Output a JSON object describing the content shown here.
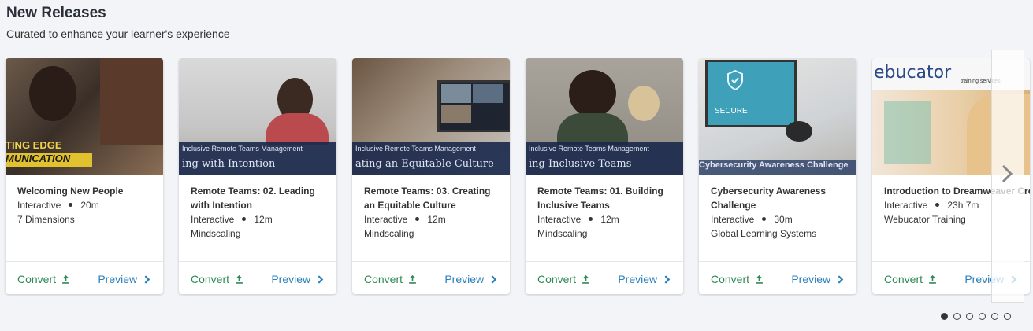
{
  "section": {
    "title": "New Releases",
    "subtitle": "Curated to enhance your learner's experience"
  },
  "colors": {
    "convert": "#2e8b57",
    "preview": "#2a7fba",
    "background": "#f3f4f7"
  },
  "cards": [
    {
      "title": "Welcoming New People",
      "type": "Interactive",
      "duration": "20m",
      "provider": "7 Dimensions",
      "thumb_text_1": "TING EDGE",
      "thumb_text_2": "MUNICATION",
      "convert": "Convert",
      "preview": "Preview"
    },
    {
      "title": "Remote Teams: 02. Leading with Intention",
      "type": "Interactive",
      "duration": "12m",
      "provider": "Mindscaling",
      "banner_1": "Inclusive Remote Teams Management",
      "banner_2": "ing with Intention",
      "convert": "Convert",
      "preview": "Preview"
    },
    {
      "title": "Remote Teams: 03. Creating an Equitable Culture",
      "type": "Interactive",
      "duration": "12m",
      "provider": "Mindscaling",
      "banner_1": "Inclusive Remote Teams Management",
      "banner_2": "ating an Equitable Culture",
      "convert": "Convert",
      "preview": "Preview"
    },
    {
      "title": "Remote Teams: 01. Building Inclusive Teams",
      "type": "Interactive",
      "duration": "12m",
      "provider": "Mindscaling",
      "banner_1": "Inclusive Remote Teams Management",
      "banner_2": "ing Inclusive Teams",
      "convert": "Convert",
      "preview": "Preview"
    },
    {
      "title": "Cybersecurity Awareness Challenge",
      "type": "Interactive",
      "duration": "30m",
      "provider": "Global Learning Systems",
      "thumb_text_1": "SECURE",
      "thumb_text_2": "Cybersecurity Awareness Challenge",
      "convert": "Convert",
      "preview": "Preview"
    },
    {
      "title": "Introduction to Dreamweaver Creative Cloud (CC)",
      "type": "Interactive",
      "duration": "23h 7m",
      "provider": "Webucator Training",
      "thumb_text_1": "ebucator",
      "thumb_text_2": "training services",
      "convert": "Convert",
      "preview": "Preview"
    }
  ],
  "icons": {
    "convert": "upload-icon",
    "preview": "chevron-right-icon",
    "next": "chevron-right-icon"
  },
  "pagination": {
    "pages": 6,
    "active": 1
  }
}
